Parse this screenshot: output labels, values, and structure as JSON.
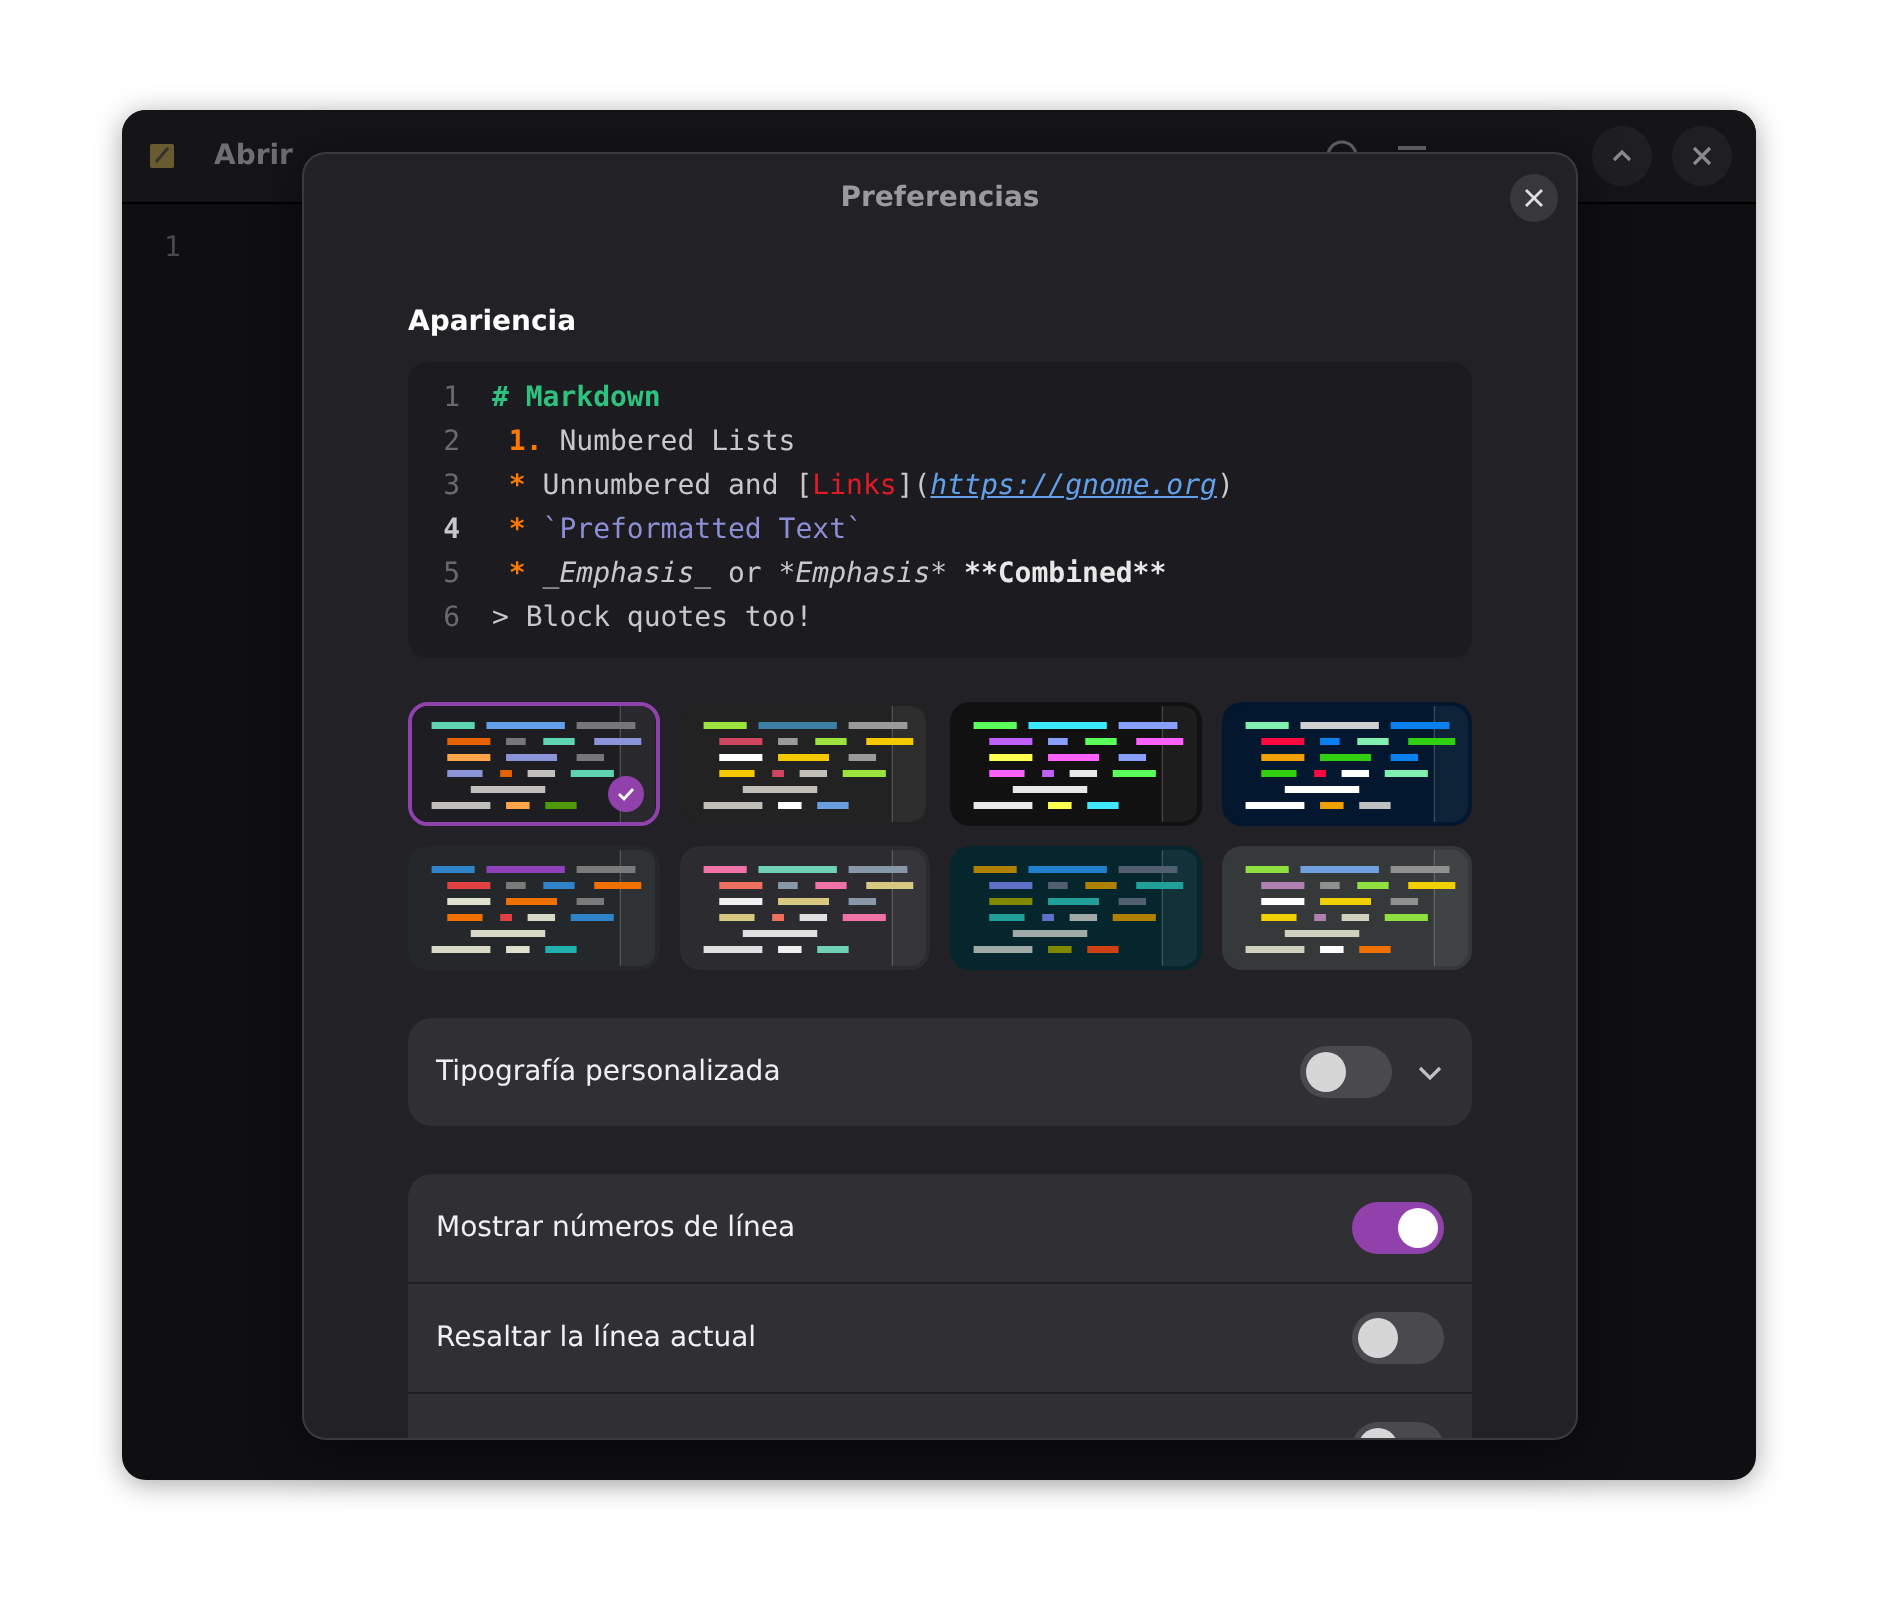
{
  "window": {
    "open_button": "Abrir",
    "line_numbers": [
      "1"
    ]
  },
  "dialog": {
    "title": "Preferencias",
    "section_title": "Apariencia",
    "preview": [
      {
        "number": "1",
        "current": false,
        "tokens": [
          {
            "kind": "heading",
            "text": "# Markdown"
          }
        ]
      },
      {
        "number": "2",
        "current": false,
        "tokens": [
          {
            "kind": "marker",
            "text": " 1."
          },
          {
            "kind": "plain",
            "text": " Numbered Lists"
          }
        ]
      },
      {
        "number": "3",
        "current": false,
        "tokens": [
          {
            "kind": "marker",
            "text": " *"
          },
          {
            "kind": "plain",
            "text": " Unnumbered and ["
          },
          {
            "kind": "link",
            "text": "Links"
          },
          {
            "kind": "plain",
            "text": "]("
          },
          {
            "kind": "url",
            "text": "https://gnome.org"
          },
          {
            "kind": "plain",
            "text": ")"
          }
        ]
      },
      {
        "number": "4",
        "current": true,
        "tokens": [
          {
            "kind": "marker",
            "text": " *"
          },
          {
            "kind": "code",
            "text": " `Preformatted Text`"
          }
        ]
      },
      {
        "number": "5",
        "current": false,
        "tokens": [
          {
            "kind": "marker",
            "text": " *"
          },
          {
            "kind": "italic",
            "text": " _Emphasis_"
          },
          {
            "kind": "plain",
            "text": " or "
          },
          {
            "kind": "italic",
            "text": "*Emphasis*"
          },
          {
            "kind": "bold",
            "text": " **Combined**"
          }
        ]
      },
      {
        "number": "6",
        "current": false,
        "tokens": [
          {
            "kind": "plain",
            "text": "> Block quotes too!"
          }
        ]
      }
    ],
    "schemes": [
      {
        "selected": true,
        "color": "#1e1e22"
      },
      {
        "selected": false,
        "color": "#222222"
      },
      {
        "selected": false,
        "color": "#111111"
      },
      {
        "selected": false,
        "color": "#03182e"
      },
      {
        "selected": false,
        "color": "#24282a"
      },
      {
        "selected": false,
        "color": "#2c2c30"
      },
      {
        "selected": false,
        "color": "#06262e"
      },
      {
        "selected": false,
        "color": "#36393a"
      }
    ],
    "custom_font": {
      "label": "Tipografía personalizada",
      "on": false,
      "expanded": false
    },
    "options": [
      {
        "label": "Mostrar números de línea",
        "on": true
      },
      {
        "label": "Resaltar la línea actual",
        "on": false
      },
      {
        "on": false
      }
    ]
  }
}
